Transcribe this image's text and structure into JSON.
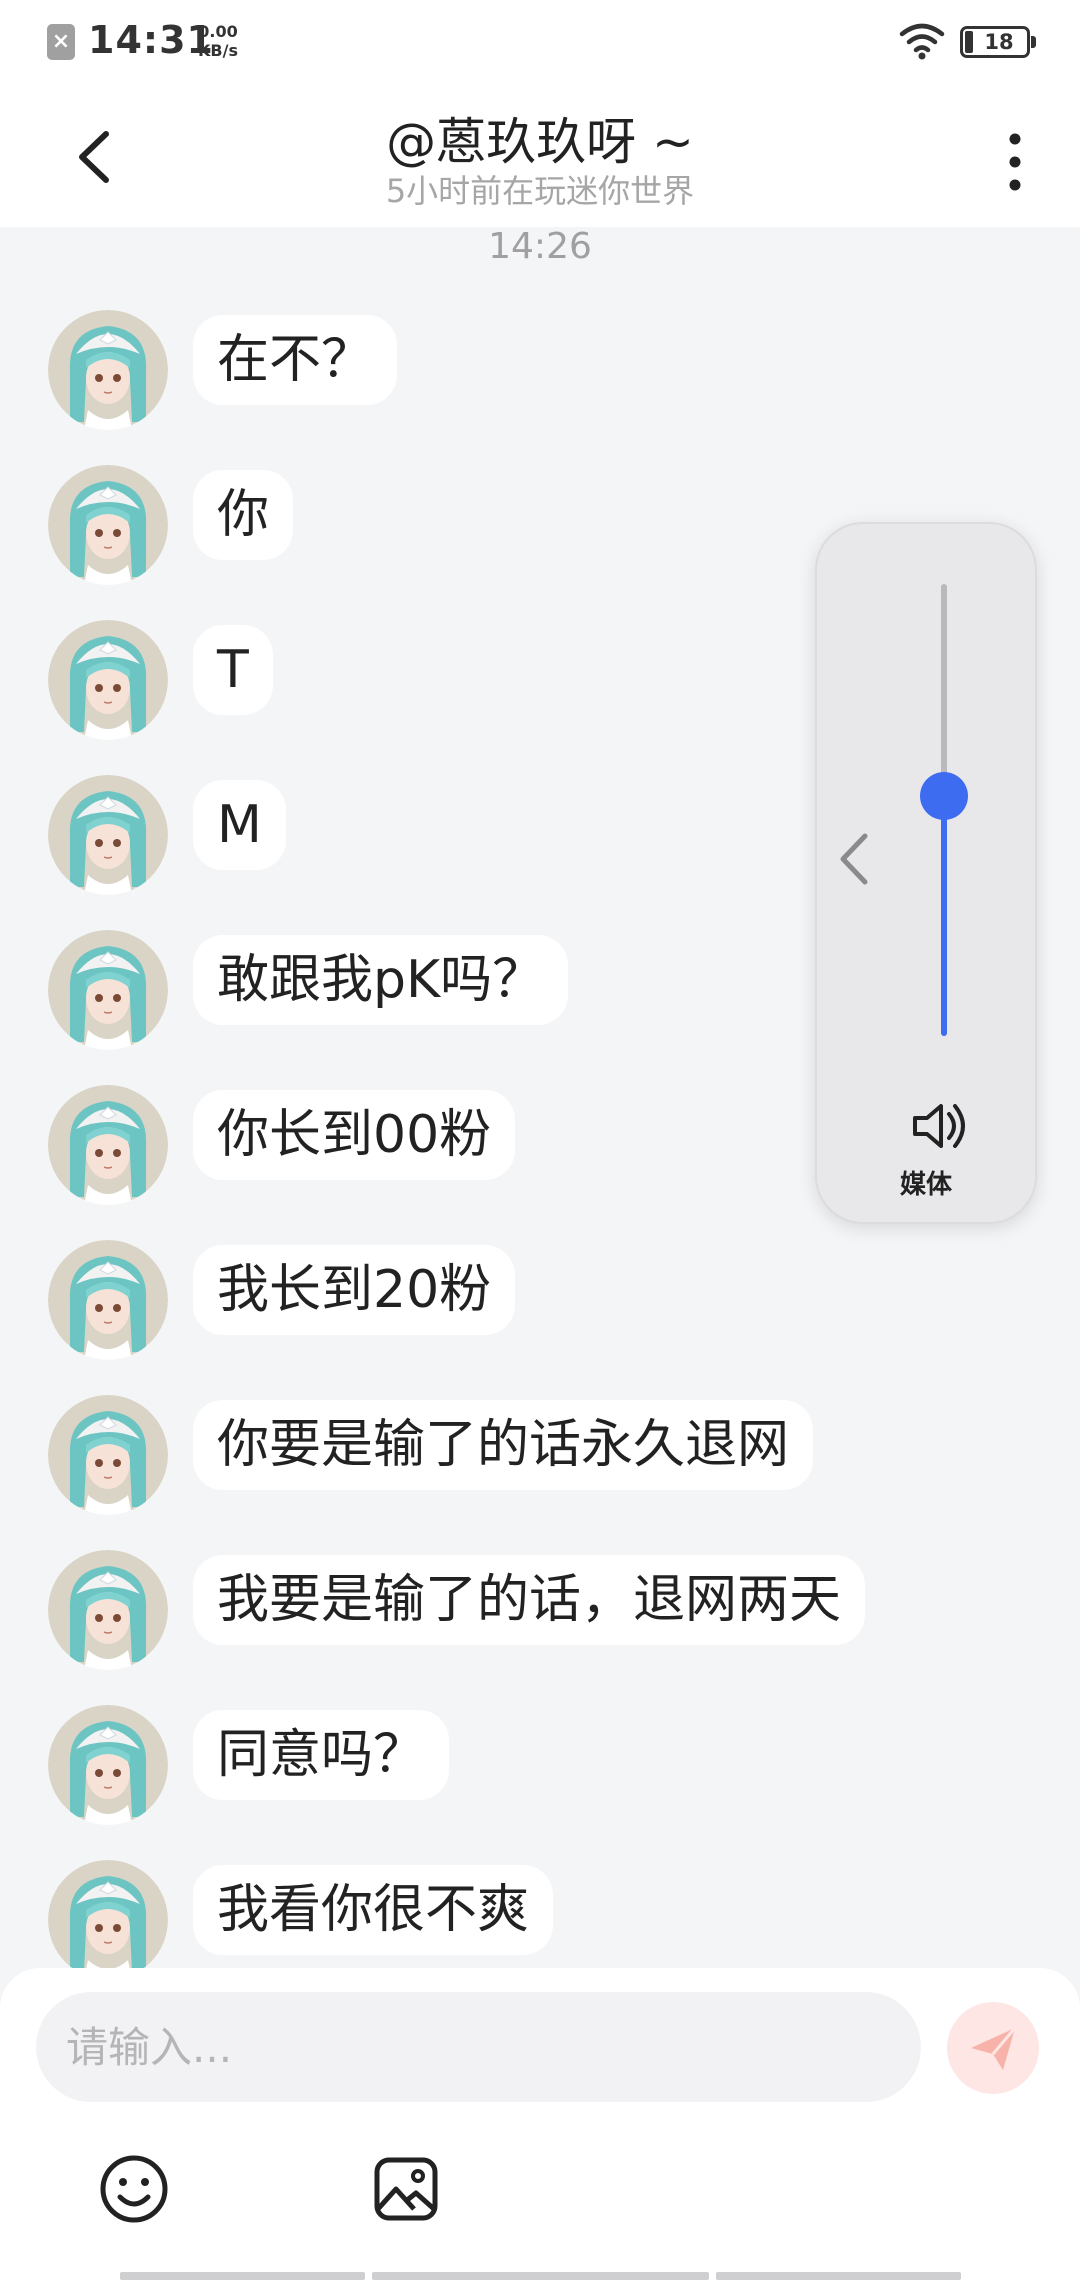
{
  "status_bar": {
    "time": "14:31",
    "net_speed_value": "0.00",
    "net_speed_unit": "KB/s",
    "battery": "18"
  },
  "header": {
    "title": "@蒽玖玖呀 ~",
    "subtitle": "5小时前在玩迷你世界"
  },
  "chat": {
    "timestamp": "14:26",
    "messages": [
      {
        "text": "在不？"
      },
      {
        "text": "你"
      },
      {
        "text": "T"
      },
      {
        "text": "M"
      },
      {
        "text": "敢跟我pK吗？"
      },
      {
        "text": "你长到00粉"
      },
      {
        "text": "我长到20粉"
      },
      {
        "text": "你要是输了的话永久退网"
      },
      {
        "text": "我要是输了的话，退网两天"
      },
      {
        "text": "同意吗？"
      },
      {
        "text": "我看你很不爽"
      }
    ]
  },
  "volume_panel": {
    "label": "媒体",
    "level": 0.53,
    "accent_color": "#3d6cf0"
  },
  "composer": {
    "placeholder": "请输入...",
    "value": "",
    "send_icon": "send-icon",
    "emoji_icon": "emoji-icon",
    "image_icon": "image-icon"
  }
}
